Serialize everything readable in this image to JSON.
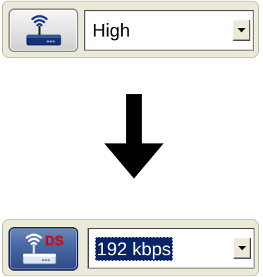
{
  "before": {
    "icon": "wifi-router-icon",
    "selected_value": "High"
  },
  "transition": {
    "icon": "arrow-down-icon"
  },
  "after": {
    "icon": "wifi-router-ds-icon",
    "icon_badge": "DS",
    "selected_value": "192 kbps"
  },
  "colors": {
    "strip_background": "#ece9d8",
    "active_button": "#3a5a96",
    "badge_red": "#e01010",
    "selection_highlight": "#0a246a"
  }
}
